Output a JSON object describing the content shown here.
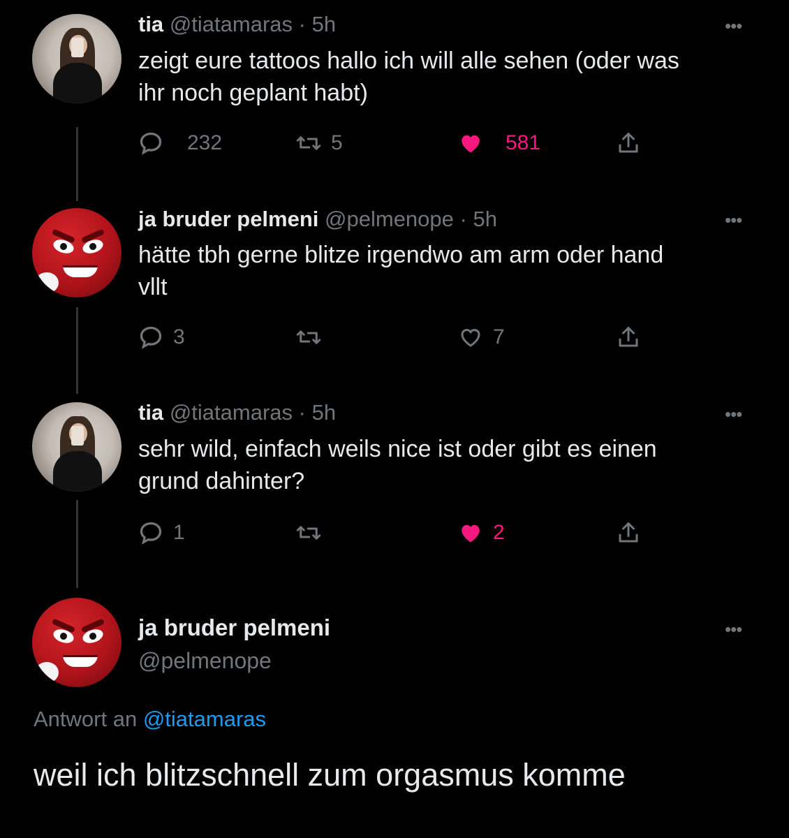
{
  "tweets": [
    {
      "name": "tia",
      "handle": "@tiatamaras",
      "time": "· 5h",
      "text_line1": "zeigt eure tattoos hallo ich will alle sehen (oder was",
      "text_line2": "ihr noch geplant habt)",
      "replies": "232",
      "retweets": "5",
      "likes": "581",
      "liked": true,
      "avatar": "avatar-tia"
    },
    {
      "name": "ja bruder pelmeni",
      "handle": "@pelmenope",
      "time": "· 5h",
      "text_line1": "hätte tbh gerne blitze irgendwo am arm oder hand",
      "text_line2": "vllt",
      "replies": "3",
      "retweets": "",
      "likes": "7",
      "liked": false,
      "avatar": "avatar-red-mm"
    },
    {
      "name": "tia",
      "handle": "@tiatamaras",
      "time": "· 5h",
      "text_line1": "sehr wild, einfach weils nice ist oder gibt es einen",
      "text_line2": "grund dahinter?",
      "replies": "1",
      "retweets": "",
      "likes": "2",
      "liked": true,
      "avatar": "avatar-tia"
    }
  ],
  "focused": {
    "name": "ja bruder pelmeni",
    "handle": "@pelmenope",
    "reply_prefix": "Antwort an",
    "reply_to": "@tiatamaras",
    "text": "weil ich blitzschnell zum orgasmus komme",
    "avatar": "avatar-red-mm"
  },
  "more_glyph": "•••",
  "colors": {
    "like": "#f91880",
    "link": "#1d9bf0",
    "muted": "#71767b",
    "text": "#e7e9ea"
  }
}
